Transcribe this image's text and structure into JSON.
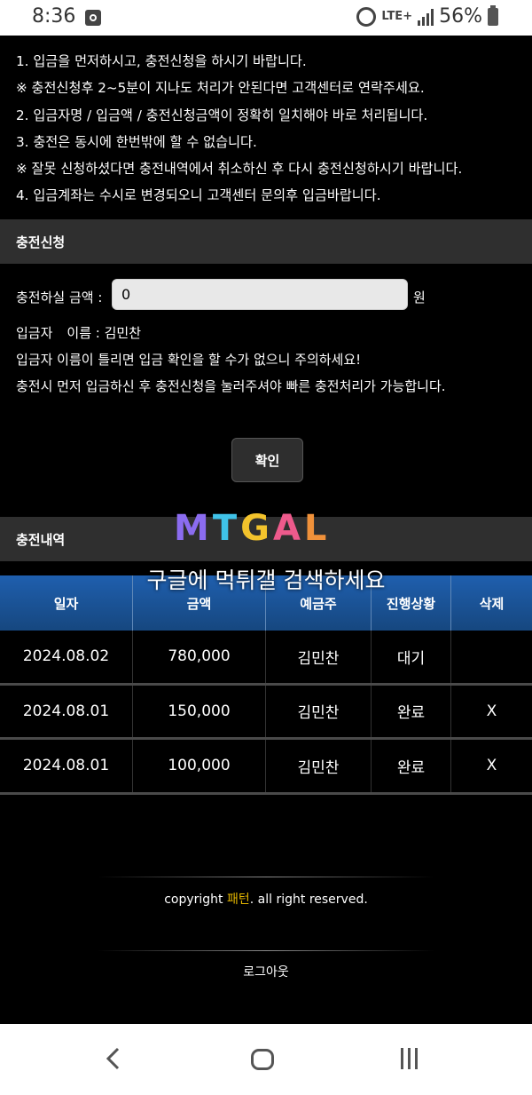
{
  "status_bar": {
    "time": "8:36",
    "network": "LTE+",
    "battery": "56%",
    "icons": [
      "clock-icon",
      "alarm-icon",
      "signal-icon",
      "battery-icon"
    ]
  },
  "notices": [
    "1. 입금을 먼저하시고, 충전신청을 하시기 바랍니다.",
    "※ 충전신청후 2~5분이 지나도 처리가 안된다면 고객센터로 연락주세요.",
    "2. 입금자명 / 입금액 / 충전신청금액이 정확히 일치해야 바로 처리됩니다.",
    "3. 충전은 동시에 한번밖에 할 수 없습니다.",
    "※ 잘못 신청하셨다면 충전내역에서 취소하신 후 다시 충전신청하시기 바랍니다.",
    "4. 입금계좌는 수시로 변경되오니 고객센터 문의후 입금바랍니다."
  ],
  "charge_request": {
    "title": "충전신청",
    "amount_label": "충전하실 금액 :",
    "amount_value": "0",
    "unit": "원",
    "depositor_label": "입금자",
    "depositor_name_label": "이름 : 김민찬",
    "info_1": "입금자 이름이 틀리면 입금 확인을 할 수가 없으니 주의하세요!",
    "info_2": "충전시 먼저 입금하신 후 충전신청을 눌러주셔야 빠른 충전처리가 가능합니다.",
    "confirm_label": "확인"
  },
  "watermark": {
    "logo_letters": [
      "M",
      "T",
      "G",
      "A",
      "L"
    ],
    "logo_colors": [
      "#8b6cf0",
      "#3fc2e8",
      "#f3c32c",
      "#ee5a8c",
      "#f0913a"
    ],
    "subtitle": "구글에 먹튀갤 검색하세요"
  },
  "history": {
    "title": "충전내역",
    "columns": [
      "일자",
      "금액",
      "예금주",
      "진행상황",
      "삭제"
    ],
    "rows": [
      {
        "date": "2024.08.02",
        "amount": "780,000",
        "holder": "김민찬",
        "status": "대기",
        "delete": ""
      },
      {
        "date": "2024.08.01",
        "amount": "150,000",
        "holder": "김민찬",
        "status": "완료",
        "delete": "X"
      },
      {
        "date": "2024.08.01",
        "amount": "100,000",
        "holder": "김민찬",
        "status": "완료",
        "delete": "X"
      }
    ]
  },
  "footer": {
    "copyright_prefix": "copyright",
    "brand": "패턴",
    "copyright_suffix": ". all right reserved.",
    "logout_label": "로그아웃",
    "brand_color": "#e3b500"
  }
}
